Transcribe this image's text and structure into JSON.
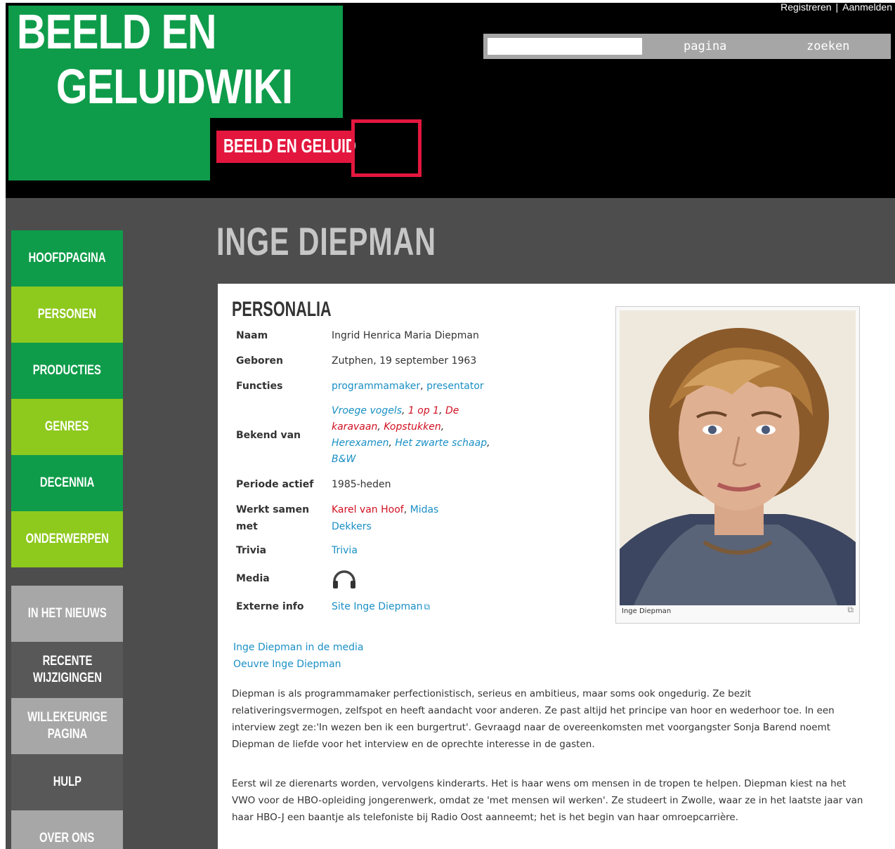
{
  "header": {
    "logo_line1": "BEELD EN",
    "logo_line2": "GELUIDWIKI",
    "sublogo": "BEELD EN GELUID",
    "register_link": "Registreren",
    "separator": "|",
    "login_link": "Aanmelden"
  },
  "search": {
    "value": "",
    "placeholder": "",
    "page_button": "pagina",
    "search_button": "zoeken"
  },
  "sidebar": {
    "items": [
      {
        "label": "HOOFDPAGINA"
      },
      {
        "label": "PERSONEN"
      },
      {
        "label": "PRODUCTIES"
      },
      {
        "label": "GENRES"
      },
      {
        "label": "DECENNIA"
      },
      {
        "label": "ONDERWERPEN"
      },
      {
        "label": "IN HET NIEUWS"
      },
      {
        "label": "RECENTE WIJZIGINGEN"
      },
      {
        "label": "WILLEKEURIGE PAGINA"
      },
      {
        "label": "HULP"
      },
      {
        "label": "OVER ONS"
      }
    ]
  },
  "page": {
    "title": "INGE DIEPMAN",
    "section_heading": "PERSONALIA"
  },
  "personalia": {
    "naam_label": "Naam",
    "naam_value": "Ingrid Henrica Maria Diepman",
    "geboren_label": "Geboren",
    "geboren_value": "Zutphen, 19 september 1963",
    "functies_label": "Functies",
    "functies": [
      "programmamaker",
      "presentator"
    ],
    "bekend_label": "Bekend van",
    "bekend": [
      "Vroege vogels",
      "1 op 1",
      "De karavaan",
      "Kopstukken",
      "Herexamen",
      "Het zwarte schaap",
      "B&W"
    ],
    "periode_label": "Periode actief",
    "periode_value": "1985-heden",
    "werkt_label_1": "Werkt samen",
    "werkt_label_2": "met",
    "werkt": [
      "Karel van Hoof",
      "Midas Dekkers"
    ],
    "trivia_label": "Trivia",
    "trivia_value": "Trivia",
    "media_label": "Media",
    "media_icon": "headphones-icon",
    "externe_label": "Externe info",
    "externe_value": "Site Inge Diepman"
  },
  "figure": {
    "caption": "Inge Diepman",
    "enlarge_icon": "enlarge-icon"
  },
  "links": {
    "media": "Inge Diepman in de media",
    "oeuvre": "Oeuvre Inge Diepman"
  },
  "paragraphs": [
    "Diepman is als programmamaker perfectionistisch, serieus en ambitieus, maar soms ook ongedurig. Ze bezit relativeringsvermogen, zelfspot en heeft aandacht voor anderen. Ze past altijd het principe van hoor en wederhoor toe. In een interview zegt ze:'In wezen ben ik een burgertrut'. Gevraagd naar de overeenkomsten met voorgangster Sonja Barend noemt Diepman de liefde voor het interview en de oprechte interesse in de gasten.",
    "Eerst wil ze dierenarts worden, vervolgens kinderarts. Het is haar wens om mensen in de tropen te helpen. Diepman kiest na het VWO voor de HBO-opleiding jongerenwerk, omdat ze 'met mensen wil werken'. Ze studeert in Zwolle, waar ze in het laatste jaar van haar HBO-J een baantje als telefoniste bij Radio Oost aanneemt; het is het begin van haar omroepcarrière."
  ],
  "colors": {
    "brand_green": "#0f9c4a",
    "lime": "#8ec91e",
    "brand_red": "#e3173e",
    "link_blue": "#1a8fc4",
    "link_red": "#d01020"
  }
}
